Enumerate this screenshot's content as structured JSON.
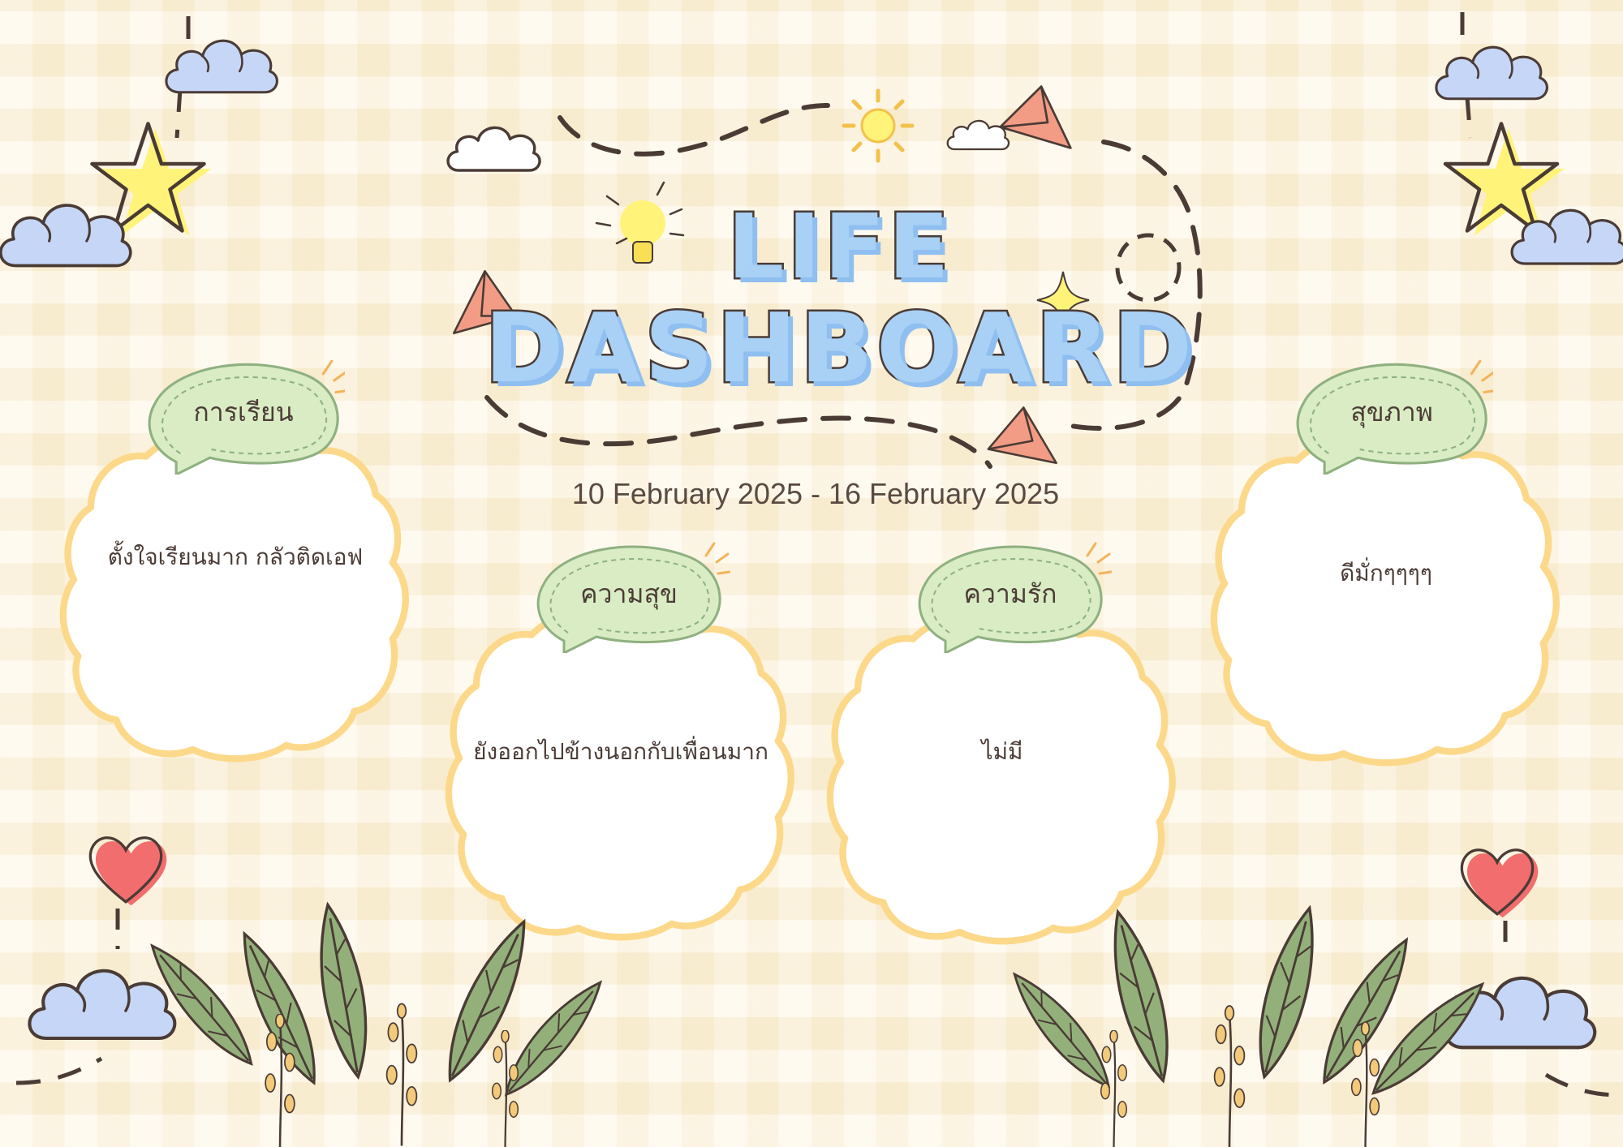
{
  "title": {
    "line1": "LIFE",
    "line2": "DASHBOARD"
  },
  "date_range": "10 February 2025 - 16 February 2025",
  "cards": [
    {
      "label": "การเรียน",
      "text": "ตั้งใจเรียนมาก กลัวติดเอฟ"
    },
    {
      "label": "ความสุข",
      "text": "ยังออกไปข้างนอกกับเพื่อนมาก"
    },
    {
      "label": "ความรัก",
      "text": "ไม่มี"
    },
    {
      "label": "สุขภาพ",
      "text": "ดีมั่กๆๆๆๆ"
    }
  ],
  "colors": {
    "background": "#fdf3dc",
    "card_border": "#fcd98a",
    "label_bubble": "#d9ecc4",
    "title_fill": "#a9d0f5",
    "outline": "#4a3b35",
    "cloud": "#c6d6f7",
    "star": "#fff37a",
    "heart": "#f26d6d",
    "plane": "#f29c85",
    "leaf": "#93b07a"
  },
  "icons": [
    "cloud-icon",
    "star-icon",
    "heart-icon",
    "sun-icon",
    "lightbulb-icon",
    "paper-plane-icon",
    "sparkle-icon",
    "leaf-icon"
  ]
}
